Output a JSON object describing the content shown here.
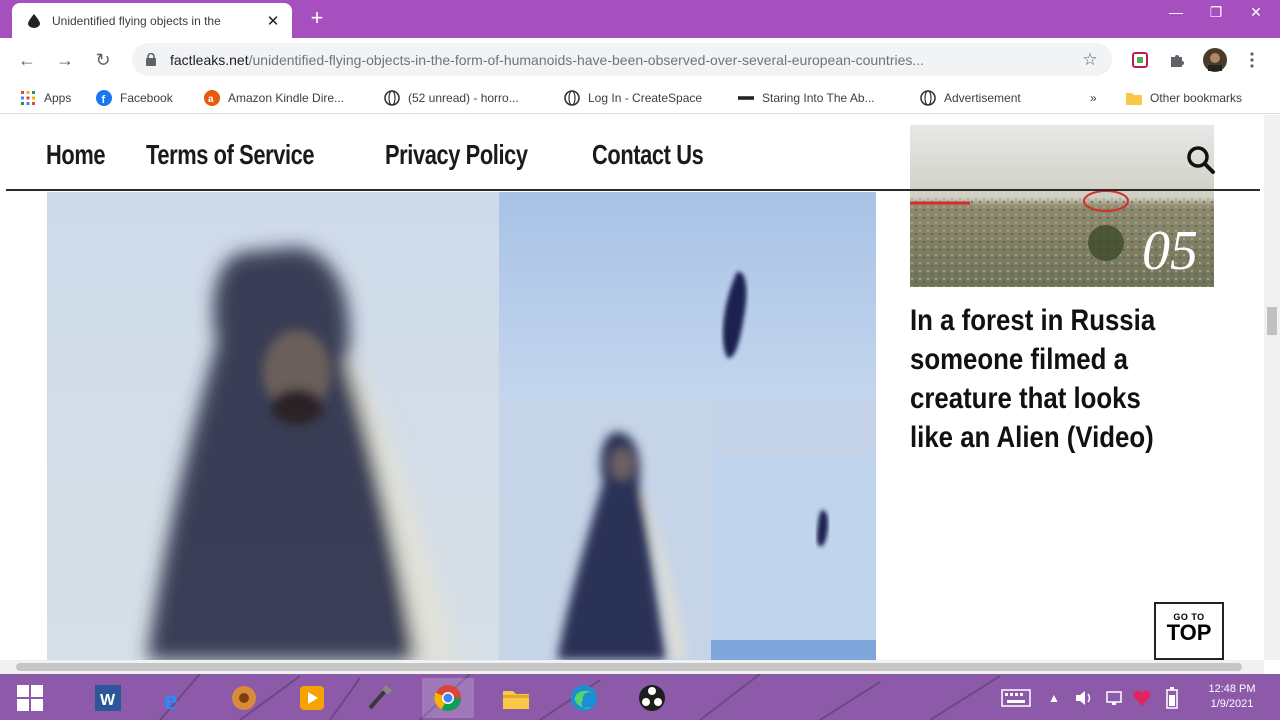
{
  "browser": {
    "tab_title": "Unidentified flying objects in the",
    "new_tab_label": "+",
    "url_domain": "factleaks.net",
    "url_path": "/unidentified-flying-objects-in-the-form-of-humanoids-have-been-observed-over-several-european-countries...",
    "colors": {
      "tab_strip": "#a64fbf",
      "omnibox": "#f1f3f4"
    }
  },
  "bookmarks": [
    {
      "label": "Apps",
      "icon": "apps-grid-icon"
    },
    {
      "label": "Facebook",
      "icon": "facebook-icon"
    },
    {
      "label": "Amazon Kindle Dire...",
      "icon": "amazon-icon"
    },
    {
      "label": "(52 unread) - horro...",
      "icon": "globe-icon"
    },
    {
      "label": "Log In - CreateSpace",
      "icon": "globe-icon"
    },
    {
      "label": "Staring Into The Ab...",
      "icon": "dash-icon"
    },
    {
      "label": "Advertisement",
      "icon": "globe-icon"
    },
    {
      "label": "»",
      "icon": "chevron-icon"
    },
    {
      "label": "Other bookmarks",
      "icon": "folder-icon"
    }
  ],
  "site": {
    "nav": [
      "Home",
      "Terms of Service",
      "Privacy Policy",
      "Contact Us"
    ],
    "sidebar_thumb_number": "05",
    "sidebar_article_title": "In a forest in Russia someone filmed a creature that looks like an Alien (Video)",
    "go_to_top_small": "GO TO",
    "go_to_top_big": "TOP"
  },
  "taskbar": {
    "apps": [
      "windows-start-icon",
      "word-icon",
      "edge-legacy-icon",
      "app-icon",
      "media-player-icon",
      "paint-icon",
      "chrome-icon",
      "file-explorer-icon",
      "edge-icon",
      "obs-icon"
    ],
    "time": "12:48 PM",
    "date": "1/9/2021",
    "color": "#8c5aa8"
  }
}
